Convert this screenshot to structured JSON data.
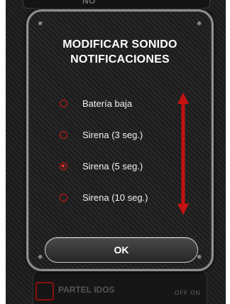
{
  "background": {
    "top_label": "NO",
    "bottom_label": "PARTEL IDOS",
    "bottom_switch": "OFF ON"
  },
  "dialog": {
    "title_line1": "MODIFICAR SONIDO",
    "title_line2": "NOTIFICACIONES",
    "options": [
      {
        "label": "Batería baja",
        "selected": false
      },
      {
        "label": "Sirena (3 seg.)",
        "selected": false
      },
      {
        "label": "Sirena (5 seg.)",
        "selected": true
      },
      {
        "label": "Sirena (10 seg.)",
        "selected": false
      }
    ],
    "ok_label": "OK",
    "scroll_icon": "double-arrow-vertical"
  },
  "colors": {
    "accent_red": "#d01818",
    "arrow_red": "#c41212",
    "dialog_border": "#8f8f8f",
    "text": "#ffffff"
  }
}
